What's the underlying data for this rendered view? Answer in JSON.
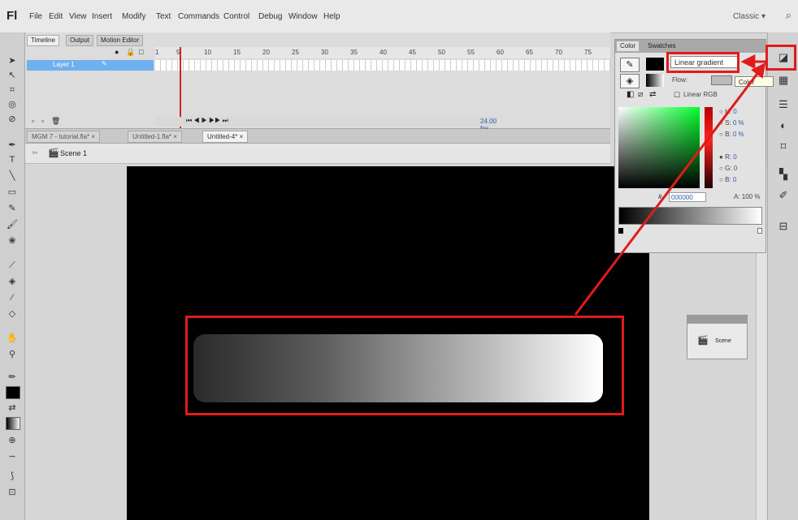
{
  "app": {
    "logo": "Fl",
    "workspace": "Classic",
    "workspace_icon": "search-icon"
  },
  "menu": [
    "File",
    "Edit",
    "View",
    "Insert",
    "Modify",
    "Text",
    "Commands",
    "Control",
    "Debug",
    "Window",
    "Help"
  ],
  "timeline": {
    "tabs": [
      "Timeline",
      "Output",
      "Motion Editor"
    ],
    "frame_numbers": [
      "1",
      "5",
      "10",
      "15",
      "20",
      "25",
      "30",
      "35",
      "40",
      "45",
      "50",
      "55",
      "60",
      "65",
      "70",
      "75"
    ],
    "layer_name": "Layer 1",
    "fps": "24.00 fps"
  },
  "doc_tabs": [
    "MGM 7 - tutorial.fla*",
    "Untitled-1.fla*",
    "Untitled-4*"
  ],
  "scene": {
    "label": "Scene 1"
  },
  "color_panel": {
    "tabs": [
      "Color",
      "Swatches"
    ],
    "type_value": "Linear gradient",
    "flow_label": "Flow:",
    "linear_rgb": "Linear RGB",
    "rows": [
      {
        "label": "H:",
        "value": "0"
      },
      {
        "label": "S:",
        "value": "0 %"
      },
      {
        "label": "B:",
        "value": "0 %"
      },
      {
        "label": "R:",
        "value": "0"
      },
      {
        "label": "G:",
        "value": "0"
      },
      {
        "label": "B:",
        "value": "0"
      }
    ],
    "hex_label": "#",
    "hex_value": "000000",
    "alpha": "A: 100 %"
  },
  "tooltip": "Color",
  "scene_panel": {
    "label": "Scene"
  },
  "colors": {
    "highlight": "#e01b1b",
    "layer_selected": "#6fb0ee",
    "playhead": "#d32222"
  }
}
